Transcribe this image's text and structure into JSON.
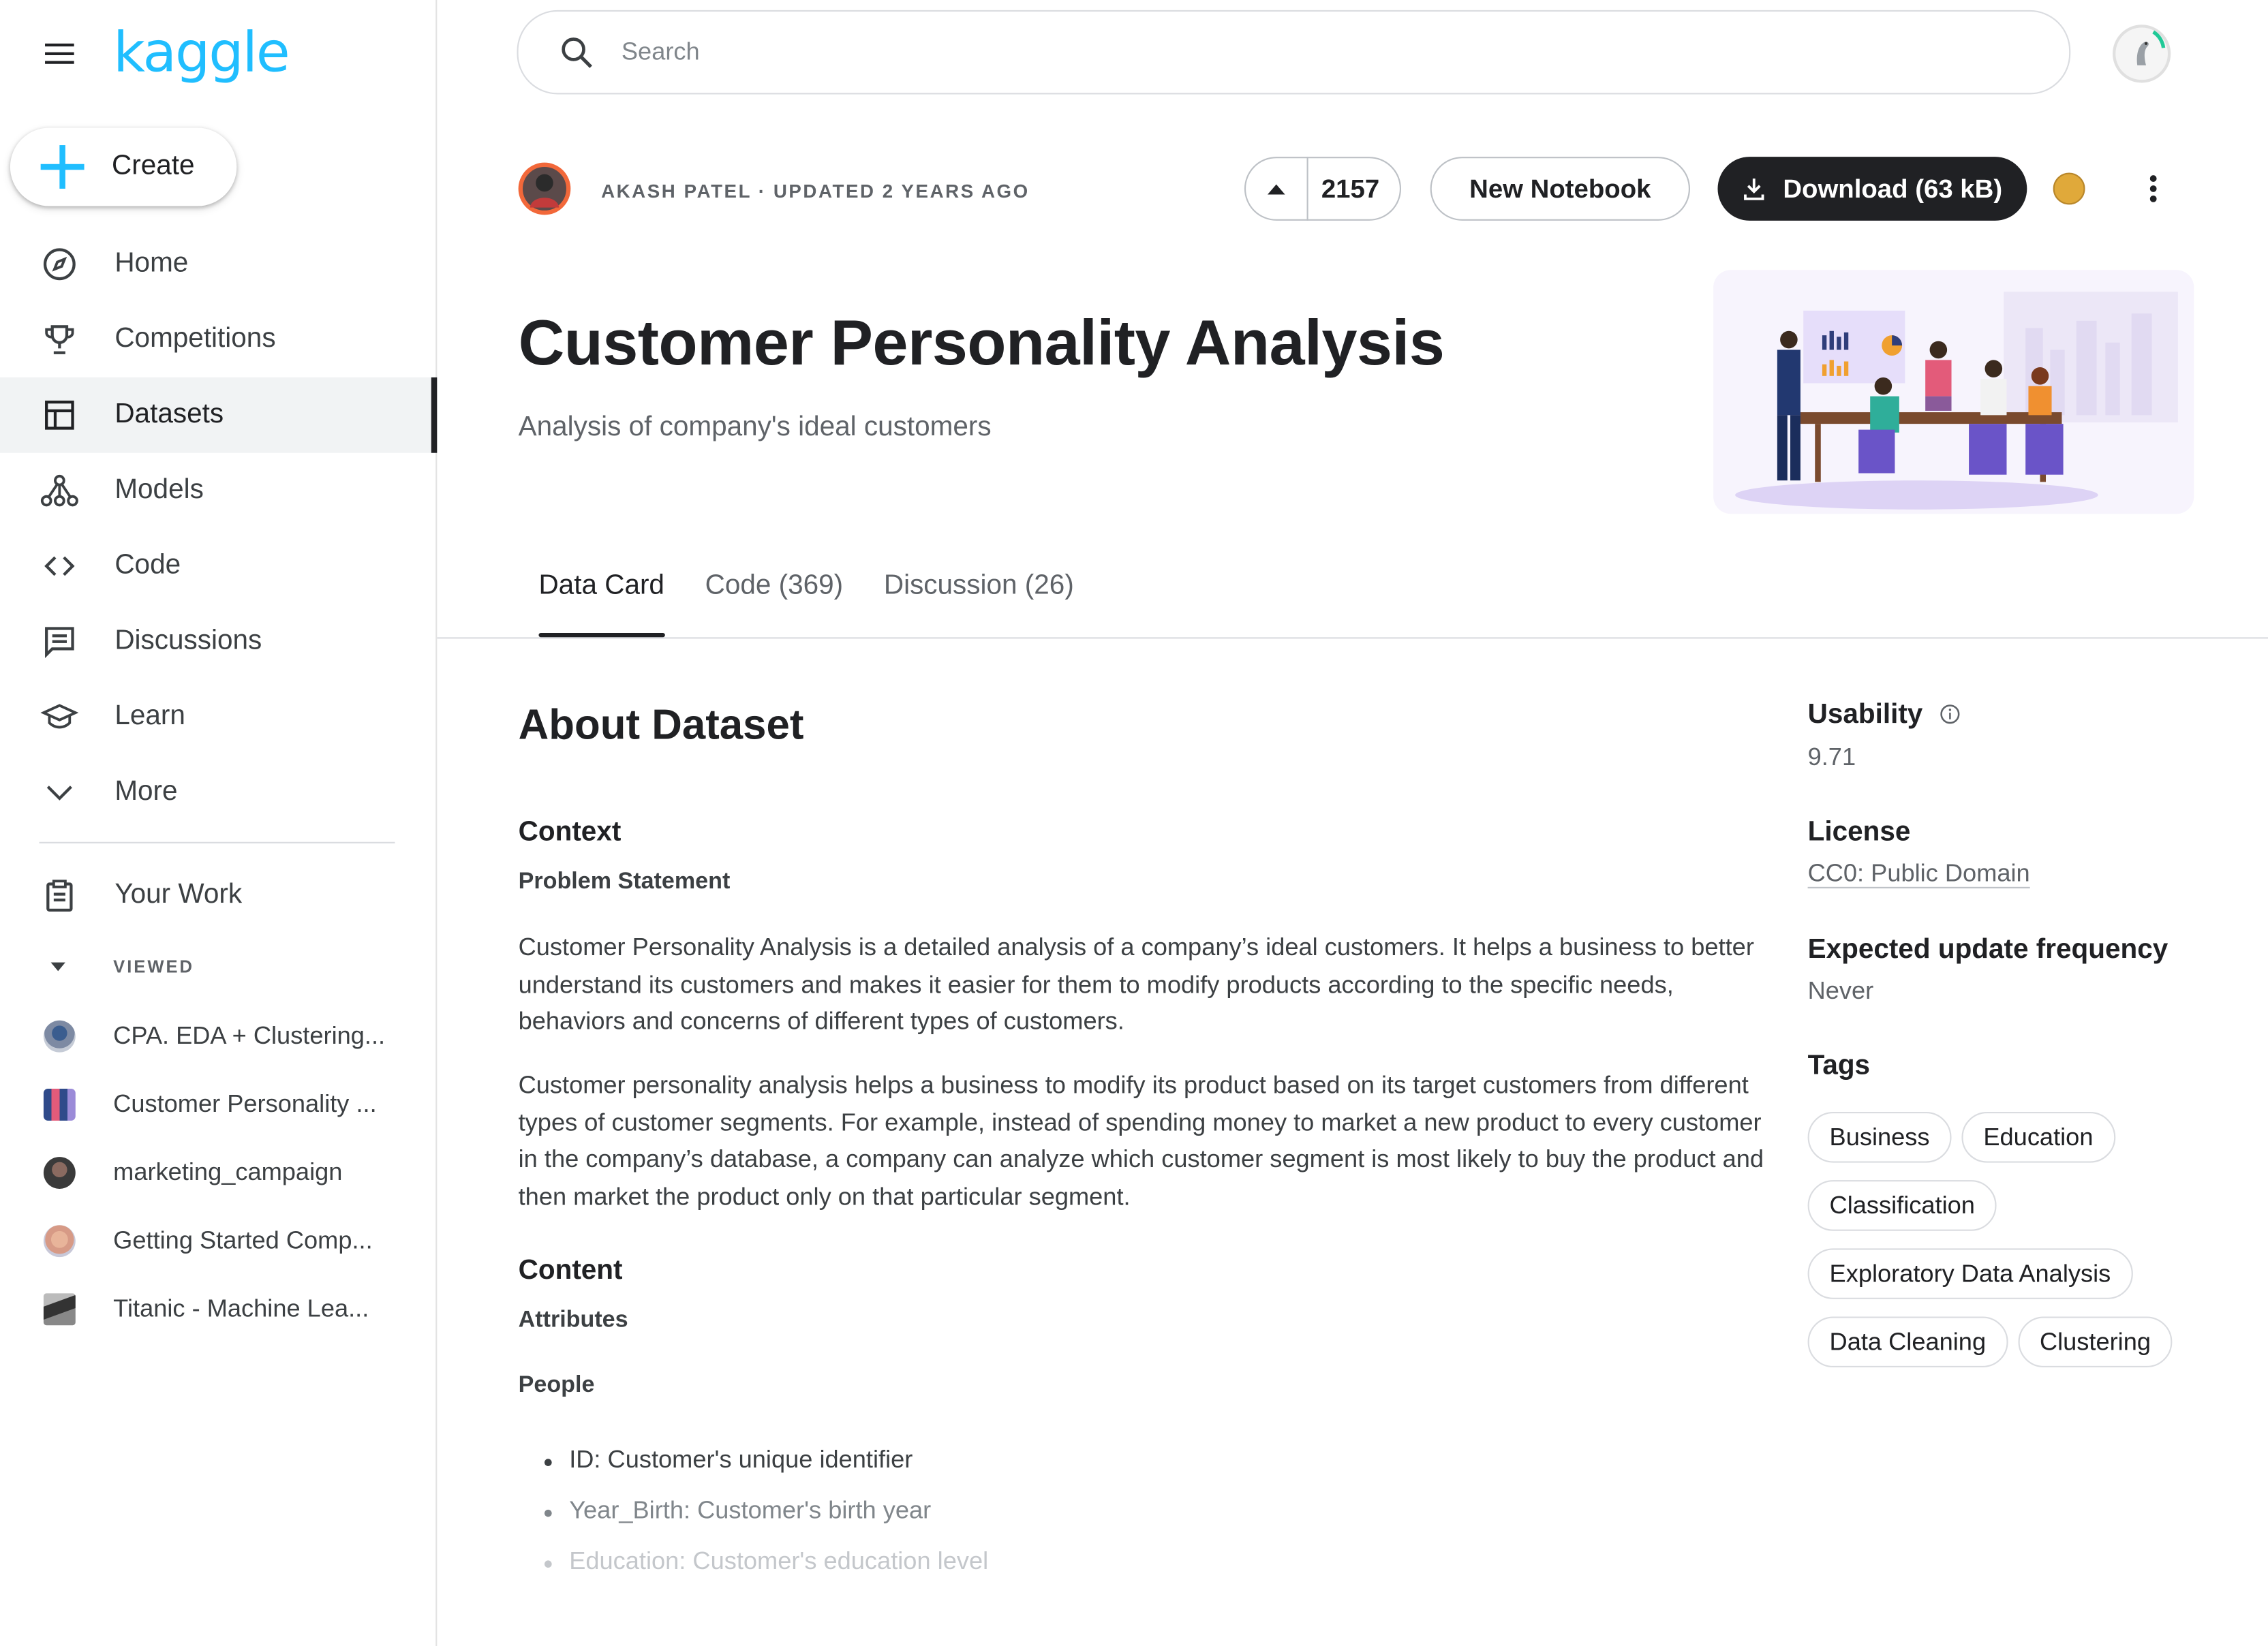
{
  "brand": {
    "logo": "kaggle"
  },
  "sidebar": {
    "create_label": "Create",
    "items": [
      {
        "label": "Home",
        "icon": "compass-icon"
      },
      {
        "label": "Competitions",
        "icon": "trophy-icon"
      },
      {
        "label": "Datasets",
        "icon": "table-icon",
        "active": true
      },
      {
        "label": "Models",
        "icon": "models-icon"
      },
      {
        "label": "Code",
        "icon": "code-icon"
      },
      {
        "label": "Discussions",
        "icon": "chat-icon"
      },
      {
        "label": "Learn",
        "icon": "graduation-cap-icon"
      },
      {
        "label": "More",
        "icon": "chevron-down-icon"
      }
    ],
    "your_work": "Your Work",
    "viewed_label": "VIEWED",
    "recent": [
      {
        "label": "CPA. EDA + Clustering..."
      },
      {
        "label": "Customer Personality ..."
      },
      {
        "label": "marketing_campaign"
      },
      {
        "label": "Getting Started Comp..."
      },
      {
        "label": "Titanic - Machine Lea..."
      }
    ]
  },
  "search": {
    "placeholder": "Search"
  },
  "dataset": {
    "author_meta": "AKASH PATEL · UPDATED 2 YEARS AGO",
    "votes": "2157",
    "new_notebook": "New Notebook",
    "download": "Download (63 kB)",
    "title": "Customer Personality Analysis",
    "subtitle": "Analysis of company's ideal customers"
  },
  "tabs": [
    {
      "label": "Data Card",
      "active": true
    },
    {
      "label": "Code (369)"
    },
    {
      "label": "Discussion (26)"
    }
  ],
  "content": {
    "about": "About Dataset",
    "context": "Context",
    "problem_statement": "Problem Statement",
    "p1": "Customer Personality Analysis is a detailed analysis of a company’s ideal customers. It helps a business to better understand its customers and makes it easier for them to modify products according to the specific needs, behaviors and concerns of different types of customers.",
    "p2": "Customer personality analysis helps a business to modify its product based on its target customers from different types of customer segments. For example, instead of spending money to market a new product to every customer in the company’s database, a company can analyze which customer segment is most likely to buy the product and then market the product only on that particular segment.",
    "content_heading": "Content",
    "attributes": "Attributes",
    "people": "People",
    "bullets": [
      "ID: Customer's unique identifier",
      "Year_Birth: Customer's birth year",
      "Education: Customer's education level"
    ]
  },
  "meta": {
    "usability_label": "Usability",
    "usability_value": "9.71",
    "license_label": "License",
    "license_value": "CC0: Public Domain",
    "frequency_label": "Expected update frequency",
    "frequency_value": "Never",
    "tags_label": "Tags",
    "tags": [
      "Business",
      "Education",
      "Classification",
      "Exploratory Data Analysis",
      "Data Cleaning",
      "Clustering"
    ]
  },
  "colors": {
    "brand": "#20beff",
    "primary_dark": "#202124",
    "accent_orange": "#f2683a"
  }
}
